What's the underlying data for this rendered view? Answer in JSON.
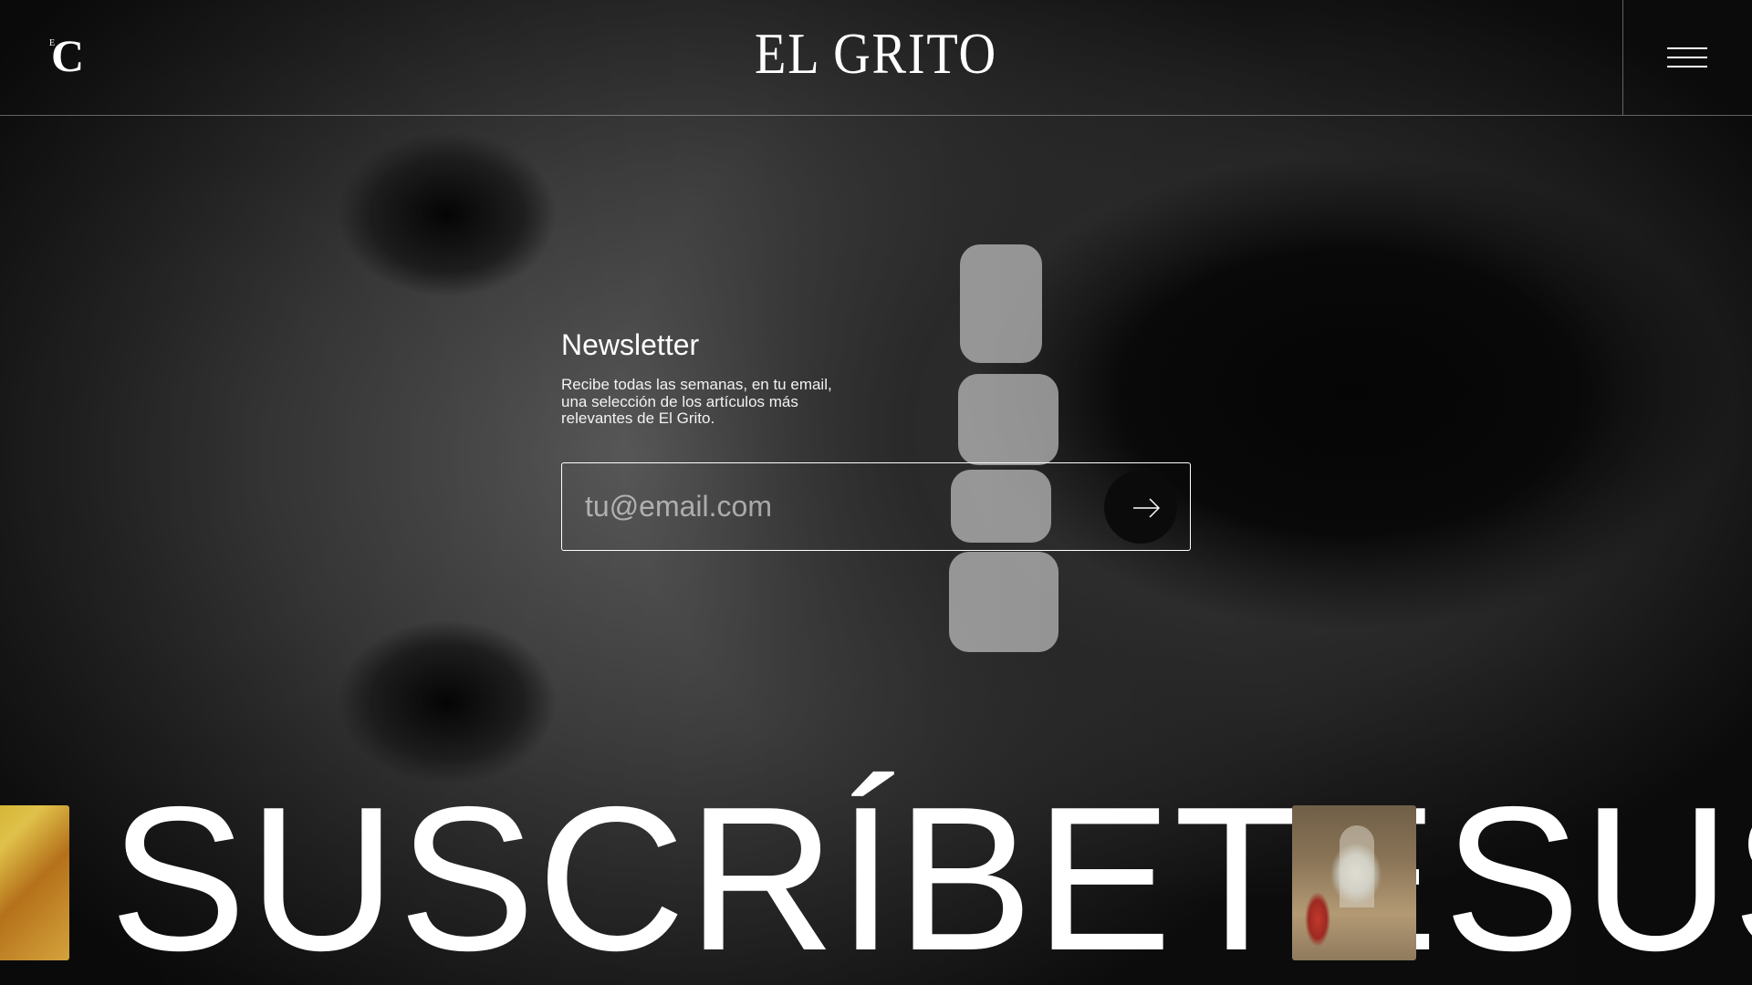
{
  "header": {
    "logo_small_letter": "C",
    "logo_small_superscript": "E",
    "brand": "EL GRITO",
    "menu_icon": "hamburger-menu-icon"
  },
  "newsletter": {
    "title": "Newsletter",
    "description": "Recibe todas las semanas, en tu email, una selección de los artículos más relevantes de El Grito.",
    "email_placeholder": "tu@email.com",
    "submit_icon": "arrow-right-icon"
  },
  "marquee": {
    "word": "SUSCRÍBETE",
    "word_partial": "SUS"
  },
  "colors": {
    "background": "#0b0b0c",
    "text": "#ffffff",
    "divider": "rgba(255,255,255,0.35)"
  }
}
